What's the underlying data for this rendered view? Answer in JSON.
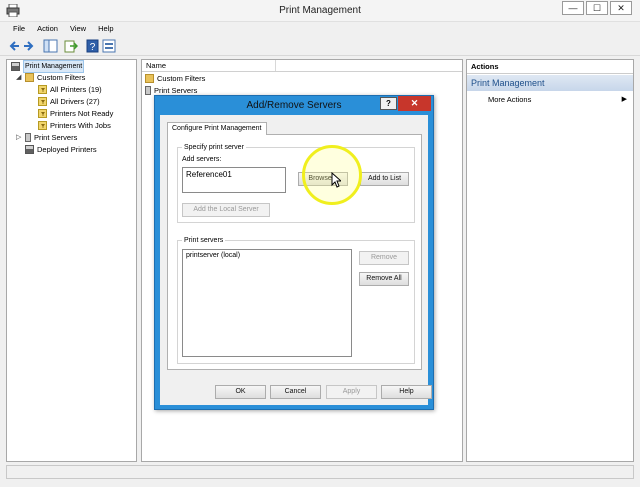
{
  "window": {
    "title": "Print Management",
    "min_glyph": "—",
    "max_glyph": "☐",
    "close_glyph": "✕"
  },
  "menu": [
    "File",
    "Action",
    "View",
    "Help"
  ],
  "toolbar": {
    "icons": [
      "back-icon",
      "forward-icon",
      "show-hide-console-tree-icon",
      "export-list-icon",
      "help-icon",
      "properties-icon"
    ]
  },
  "tree": {
    "items": [
      {
        "label": "Print Management",
        "icon": "print-management-icon"
      },
      {
        "label": "Custom Filters",
        "icon": "folder-icon",
        "expander": "◢"
      },
      {
        "label": "All Printers (19)",
        "icon": "filter-icon"
      },
      {
        "label": "All Drivers (27)",
        "icon": "filter-icon"
      },
      {
        "label": "Printers Not Ready",
        "icon": "filter-icon"
      },
      {
        "label": "Printers With Jobs",
        "icon": "filter-icon"
      },
      {
        "label": "Print Servers",
        "icon": "server-icon",
        "expander": "▷"
      },
      {
        "label": "Deployed Printers",
        "icon": "printer-icon"
      }
    ]
  },
  "list": {
    "column_name": "Name",
    "rows": [
      "Custom Filters",
      "Print Servers"
    ]
  },
  "actions": {
    "header": "Actions",
    "section": "Print Management",
    "more": "More Actions",
    "more_arrow": "▶"
  },
  "dialog": {
    "title": "Add/Remove Servers",
    "help_glyph": "?",
    "close_glyph": "✕",
    "tab": "Configure Print Management",
    "specify_group": "Specify print server",
    "add_servers_label": "Add servers:",
    "add_servers_value": "Reference01",
    "browse": "Browse...",
    "add_to_list": "Add to List",
    "add_local": "Add the Local Server",
    "print_servers_group": "Print servers",
    "print_servers_items": [
      "printserver (local)"
    ],
    "remove": "Remove",
    "remove_all": "Remove All",
    "ok": "OK",
    "cancel": "Cancel",
    "apply": "Apply",
    "help": "Help"
  }
}
